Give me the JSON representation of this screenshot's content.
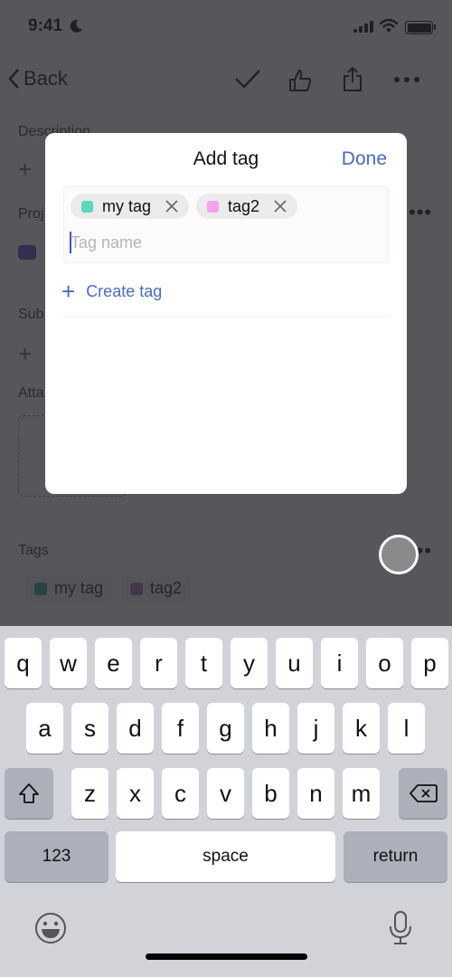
{
  "status_bar": {
    "time": "9:41"
  },
  "nav": {
    "back_label": "Back",
    "icons": [
      "checkmark-icon",
      "thumbs-up-icon",
      "share-icon",
      "more-icon"
    ]
  },
  "page": {
    "sections": {
      "description": "Description",
      "project": "Proj",
      "subtasks": "Sub",
      "attachments": "Atta",
      "tags": "Tags"
    },
    "tags": [
      {
        "name": "my tag",
        "color": "#3aa88e"
      },
      {
        "name": "tag2",
        "color": "#a679b3"
      }
    ]
  },
  "modal": {
    "title": "Add tag",
    "done_label": "Done",
    "selected_tags": [
      {
        "name": "my tag",
        "color": "#5cd6c0"
      },
      {
        "name": "tag2",
        "color": "#f5a3f0"
      }
    ],
    "input_value": "",
    "input_placeholder": "Tag name",
    "create_label": "Create tag",
    "accent_color": "#4a6bbd"
  },
  "keyboard": {
    "row1": [
      "q",
      "w",
      "e",
      "r",
      "t",
      "y",
      "u",
      "i",
      "o",
      "p"
    ],
    "row2": [
      "a",
      "s",
      "d",
      "f",
      "g",
      "h",
      "j",
      "k",
      "l"
    ],
    "row3": [
      "z",
      "x",
      "c",
      "v",
      "b",
      "n",
      "m"
    ],
    "numbers_label": "123",
    "space_label": "space",
    "return_label": "return"
  }
}
